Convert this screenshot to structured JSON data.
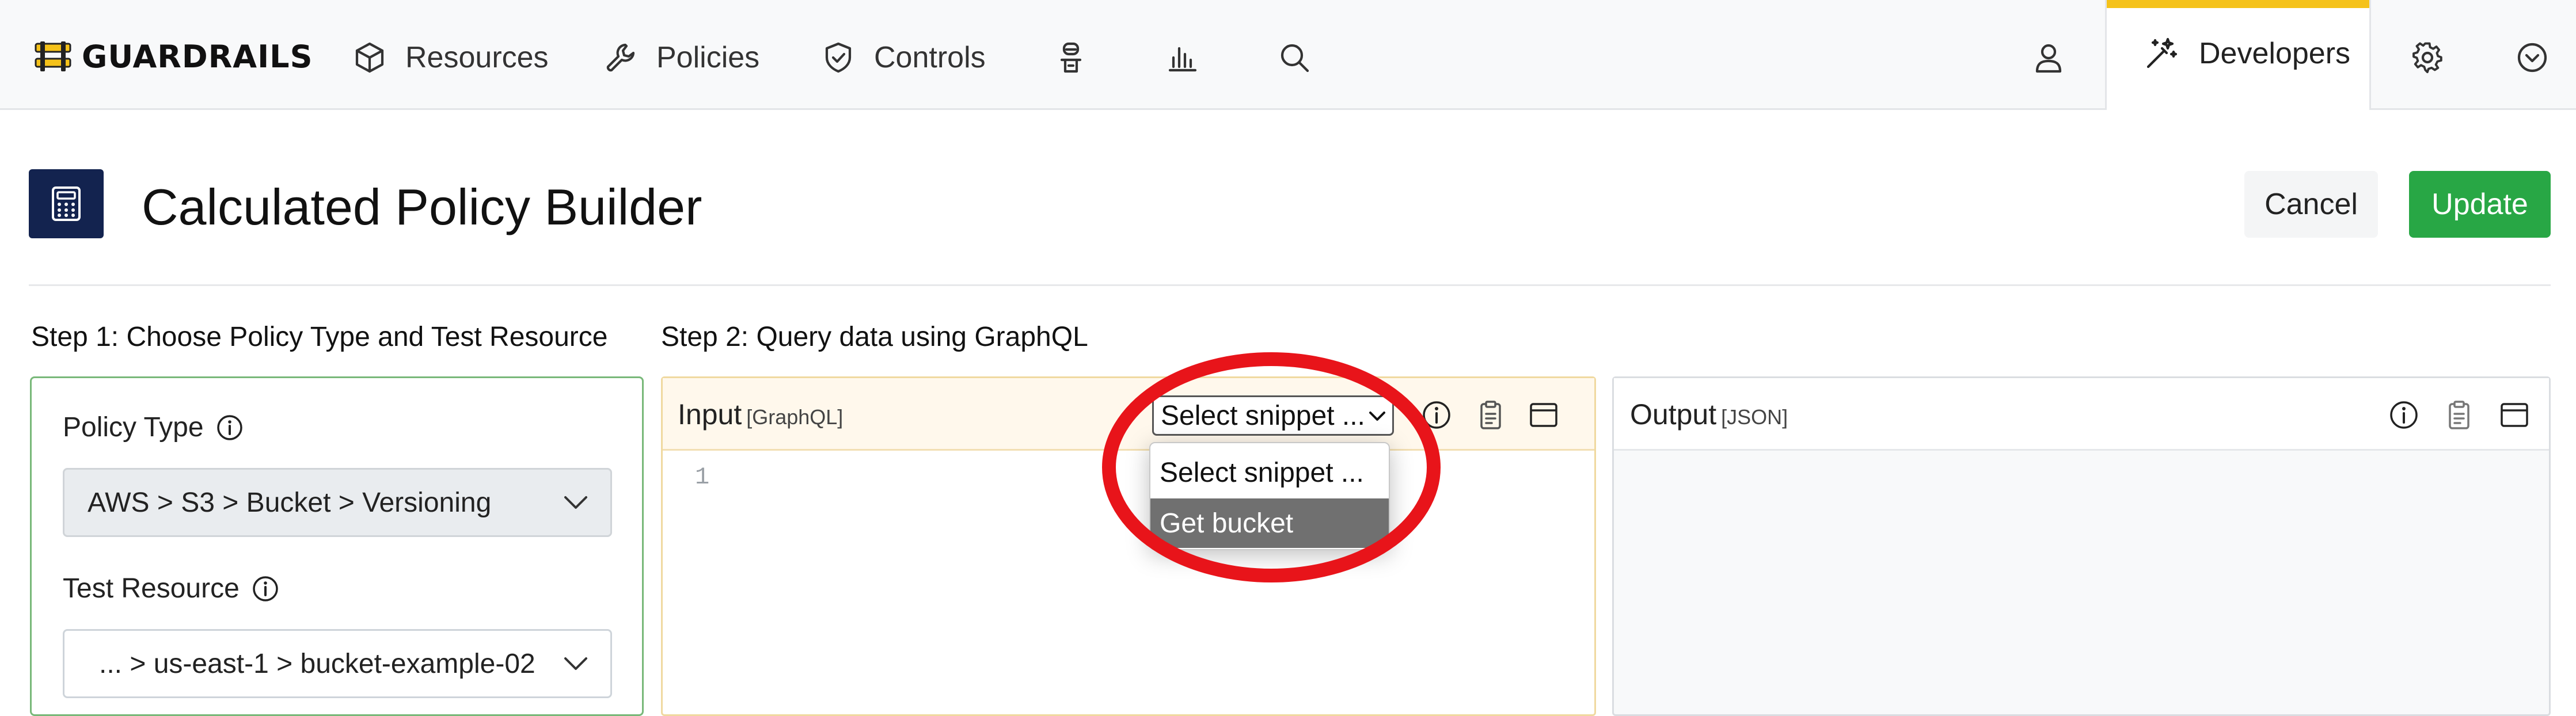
{
  "app": {
    "brand": "GUARDRAILS"
  },
  "nav": {
    "items": [
      {
        "label": "Resources",
        "icon": "cube-icon"
      },
      {
        "label": "Policies",
        "icon": "wrench-icon"
      },
      {
        "label": "Controls",
        "icon": "shield-check-icon"
      }
    ],
    "icon_items": [
      "agent-icon",
      "bar-chart-icon",
      "search-icon"
    ],
    "right": {
      "user_icon": "user-icon",
      "active_tab": "Developers",
      "settings_icon": "gear-icon",
      "menu_icon": "chevron-down-circle-icon"
    },
    "accent_color": "#f5c21a"
  },
  "header": {
    "title": "Calculated Policy Builder",
    "icon": "calculator-icon",
    "icon_bg": "#13234f",
    "cancel_label": "Cancel",
    "update_label": "Update",
    "update_color": "#28a745"
  },
  "step1": {
    "heading": "Step 1: Choose Policy Type and Test Resource",
    "policy_type_label": "Policy Type",
    "policy_type_value": "AWS > S3 > Bucket > Versioning",
    "test_resource_label": "Test Resource",
    "test_resource_value": "... > us-east-1 > bucket-example-02"
  },
  "step2": {
    "heading": "Step 2: Query data using GraphQL",
    "input": {
      "title": "Input",
      "subtitle": "[GraphQL]",
      "snippet_selected": "Select snippet ...",
      "snippet_options": [
        "Select snippet ...",
        "Get bucket"
      ],
      "line_number": "1"
    },
    "output": {
      "title": "Output",
      "subtitle": "[JSON]"
    }
  },
  "annotation_color": "#e8141a"
}
